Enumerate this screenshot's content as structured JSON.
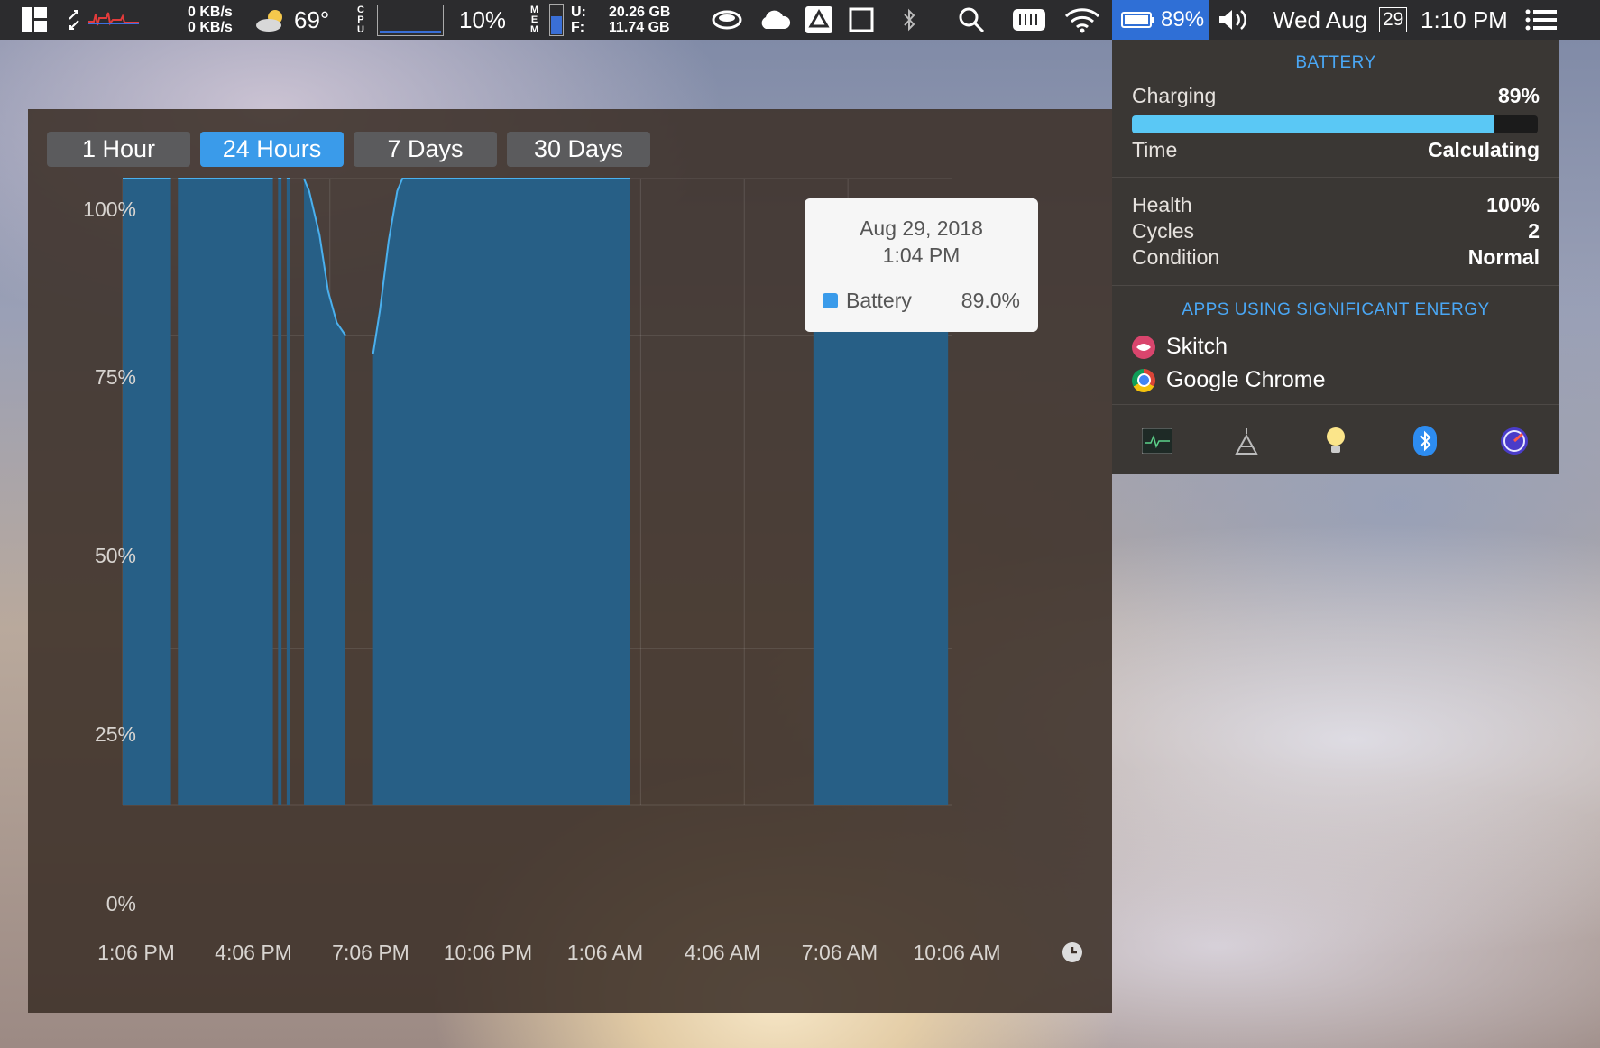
{
  "menubar": {
    "net_up": "0 KB/s",
    "net_down": "0 KB/s",
    "weather_temp": "69°",
    "cpu_label_c": "C",
    "cpu_label_p": "P",
    "cpu_label_u": "U",
    "cpu_percent": "10%",
    "mem_label_m": "M",
    "mem_label_e": "E",
    "mem_label_m2": "M",
    "mem_u_label": "U:",
    "mem_f_label": "F:",
    "mem_used": "20.26 GB",
    "mem_free": "11.74 GB",
    "battery_percent": "89%",
    "date": "Wed Aug",
    "day": "29",
    "time": "1:10 PM"
  },
  "history": {
    "tabs": [
      "1 Hour",
      "24 Hours",
      "7 Days",
      "30 Days"
    ],
    "active_tab": "24 Hours",
    "tooltip": {
      "date": "Aug 29, 2018",
      "time": "1:04 PM",
      "series": "Battery",
      "value": "89.0%"
    }
  },
  "chart_data": {
    "type": "area",
    "series": [
      {
        "name": "Battery",
        "color": "#3a9bea"
      }
    ],
    "yticks": [
      "100%",
      "75%",
      "50%",
      "25%",
      "0%"
    ],
    "xticks": [
      "1:06 PM",
      "4:06 PM",
      "7:06 PM",
      "10:06 PM",
      "1:06 AM",
      "4:06 AM",
      "7:06 AM",
      "10:06 AM"
    ],
    "ylim": [
      0,
      100
    ],
    "x_range_hours": [
      0,
      24
    ],
    "segments": [
      [
        [
          0.0,
          100
        ],
        [
          1.4,
          100
        ]
      ],
      [
        [
          1.6,
          100
        ],
        [
          4.35,
          100
        ]
      ],
      [
        [
          4.5,
          100
        ],
        [
          4.6,
          100
        ]
      ],
      [
        [
          4.75,
          100
        ],
        [
          4.85,
          100
        ]
      ],
      [
        [
          5.25,
          100
        ],
        [
          5.4,
          98
        ],
        [
          5.7,
          91
        ],
        [
          5.95,
          82
        ],
        [
          6.2,
          77
        ],
        [
          6.45,
          75
        ]
      ],
      [
        [
          7.25,
          72
        ],
        [
          7.45,
          79
        ],
        [
          7.7,
          90
        ],
        [
          7.95,
          98
        ],
        [
          8.1,
          100
        ],
        [
          14.7,
          100
        ]
      ],
      [
        [
          20.0,
          95
        ],
        [
          23.05,
          95
        ],
        [
          23.3,
          93
        ],
        [
          23.55,
          92
        ],
        [
          23.9,
          89
        ]
      ]
    ],
    "current_point": [
      23.95,
      89
    ]
  },
  "battery_panel": {
    "title": "BATTERY",
    "charging_label": "Charging",
    "charge_percent": "89%",
    "charge_fraction": 0.89,
    "time_label": "Time",
    "time_value": "Calculating",
    "health_label": "Health",
    "health_value": "100%",
    "cycles_label": "Cycles",
    "cycles_value": "2",
    "condition_label": "Condition",
    "condition_value": "Normal",
    "apps_title": "APPS USING SIGNIFICANT ENERGY",
    "apps": [
      "Skitch",
      "Google Chrome"
    ]
  }
}
